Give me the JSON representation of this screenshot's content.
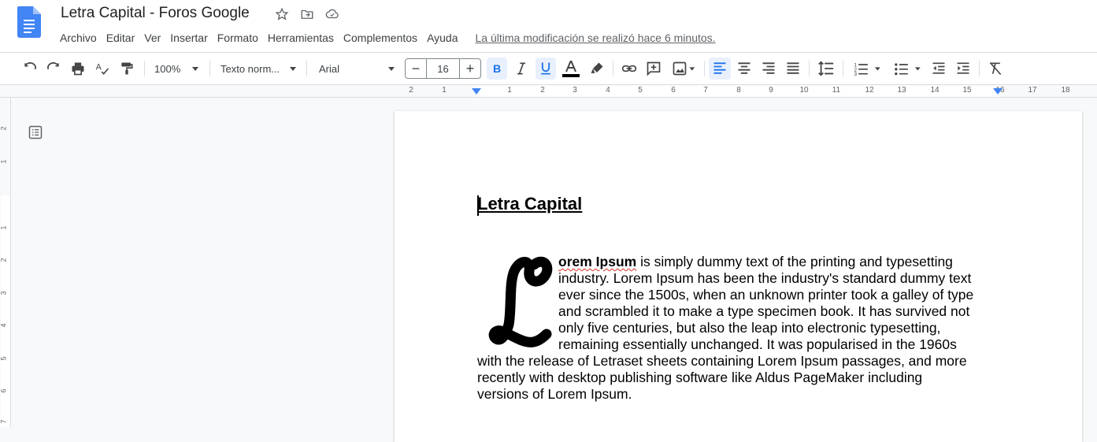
{
  "app": {
    "title": "Letra Capital - Foros Google",
    "last_modified": "La última modificación se realizó hace 6 minutos."
  },
  "menu": [
    "Archivo",
    "Editar",
    "Ver",
    "Insertar",
    "Formato",
    "Herramientas",
    "Complementos",
    "Ayuda"
  ],
  "toolbar": {
    "zoom": "100%",
    "style": "Texto norm...",
    "font": "Arial",
    "font_size": "16",
    "minus": "−",
    "plus": "+"
  },
  "ruler": {
    "h_labels": [
      "2",
      "1",
      "1",
      "2",
      "3",
      "4",
      "5",
      "6",
      "7",
      "8",
      "9",
      "10",
      "11",
      "12",
      "13",
      "14",
      "15",
      "16",
      "17",
      "18"
    ],
    "v_labels": [
      "2",
      "1",
      "1",
      "2",
      "3",
      "4",
      "5",
      "6",
      "7"
    ]
  },
  "document": {
    "heading": "Letra Capital",
    "dropcap": "L",
    "para_bold": "orem Ipsum",
    "lines": [
      " is simply dummy text of the printing and typesetting",
      "industry. Lorem Ipsum has been the industry's standard dummy text",
      "ever since the 1500s, when an unknown printer took a galley of type",
      "and scrambled it to make a type specimen book. It has survived not",
      "only five centuries, but also the leap into electronic typesetting,",
      "remaining essentially unchanged. It was popularised in the 1960s",
      "with the release of Letraset sheets containing Lorem Ipsum passages, and more",
      "recently with desktop publishing software like Aldus PageMaker including",
      "versions of Lorem Ipsum."
    ]
  },
  "colors": {
    "accent": "#1a73e8",
    "docs_blue": "#4285f4",
    "active_bg": "#e8f0fe"
  }
}
